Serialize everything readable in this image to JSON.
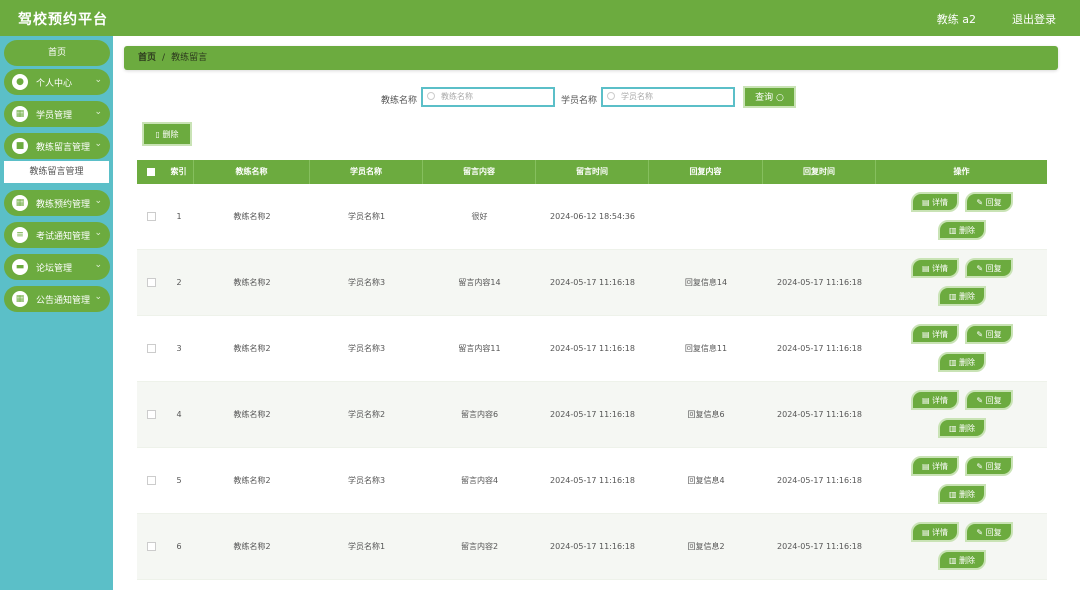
{
  "header": {
    "title": "驾校预约平台",
    "user": "教练 a2",
    "logout": "退出登录"
  },
  "sidebar": {
    "home": "首页",
    "items": [
      {
        "label": "个人中心",
        "icon": "user-icon",
        "glyph": "●"
      },
      {
        "label": "学员管理",
        "icon": "grid-icon",
        "glyph": "▦"
      },
      {
        "label": "教练留言管理",
        "icon": "folder-icon",
        "glyph": "■"
      },
      {
        "label": "教练预约管理",
        "icon": "grid-icon",
        "glyph": "▦"
      },
      {
        "label": "考试通知管理",
        "icon": "list-icon",
        "glyph": "≡"
      },
      {
        "label": "论坛管理",
        "icon": "briefcase-icon",
        "glyph": "▬"
      },
      {
        "label": "公告通知管理",
        "icon": "grid-icon",
        "glyph": "▦"
      }
    ],
    "submenu": "教练留言管理"
  },
  "breadcrumb": {
    "home": "首页",
    "sep": "/",
    "current": "教练留言"
  },
  "search": {
    "coach_label": "教练名称",
    "coach_placeholder": "教练名称",
    "student_label": "学员名称",
    "student_placeholder": "学员名称",
    "query_label": "查询 ○"
  },
  "toolbar": {
    "delete_label": "▯ 删除"
  },
  "table": {
    "headers": [
      "索引",
      "教练名称",
      "学员名称",
      "留言内容",
      "留言时间",
      "回复内容",
      "回复时间",
      "操作"
    ],
    "rows": [
      {
        "index": "1",
        "coach": "教练名称2",
        "student": "学员名称1",
        "content": "很好",
        "time": "2024-06-12 18:54:36",
        "reply": "",
        "reply_time": ""
      },
      {
        "index": "2",
        "coach": "教练名称2",
        "student": "学员名称3",
        "content": "留言内容14",
        "time": "2024-05-17 11:16:18",
        "reply": "回复信息14",
        "reply_time": "2024-05-17 11:16:18"
      },
      {
        "index": "3",
        "coach": "教练名称2",
        "student": "学员名称3",
        "content": "留言内容11",
        "time": "2024-05-17 11:16:18",
        "reply": "回复信息11",
        "reply_time": "2024-05-17 11:16:18"
      },
      {
        "index": "4",
        "coach": "教练名称2",
        "student": "学员名称2",
        "content": "留言内容6",
        "time": "2024-05-17 11:16:18",
        "reply": "回复信息6",
        "reply_time": "2024-05-17 11:16:18"
      },
      {
        "index": "5",
        "coach": "教练名称2",
        "student": "学员名称3",
        "content": "留言内容4",
        "time": "2024-05-17 11:16:18",
        "reply": "回复信息4",
        "reply_time": "2024-05-17 11:16:18"
      },
      {
        "index": "6",
        "coach": "教练名称2",
        "student": "学员名称1",
        "content": "留言内容2",
        "time": "2024-05-17 11:16:18",
        "reply": "回复信息2",
        "reply_time": "2024-05-17 11:16:18"
      }
    ],
    "ops": {
      "detail": "▤ 详情",
      "reply": "✎ 回复",
      "delete": "▥ 删除"
    }
  },
  "colors": {
    "primary": "#6cab3f",
    "sidebar": "#5bbfc8"
  }
}
